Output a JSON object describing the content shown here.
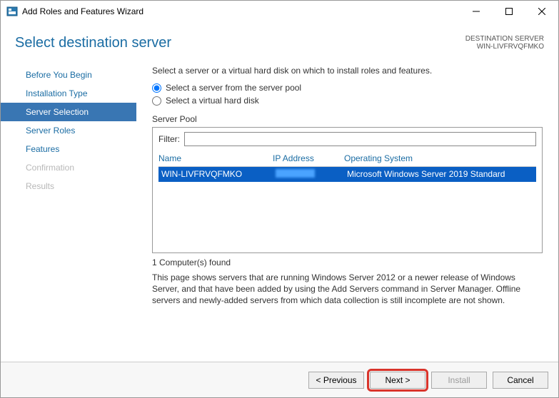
{
  "window": {
    "title": "Add Roles and Features Wizard"
  },
  "header": {
    "title": "Select destination server",
    "destLabel": "DESTINATION SERVER",
    "destValue": "WIN-LIVFRVQFMKO"
  },
  "sidebar": {
    "items": [
      {
        "label": "Before You Begin",
        "state": "normal"
      },
      {
        "label": "Installation Type",
        "state": "normal"
      },
      {
        "label": "Server Selection",
        "state": "active"
      },
      {
        "label": "Server Roles",
        "state": "normal"
      },
      {
        "label": "Features",
        "state": "normal"
      },
      {
        "label": "Confirmation",
        "state": "disabled"
      },
      {
        "label": "Results",
        "state": "disabled"
      }
    ]
  },
  "main": {
    "intro": "Select a server or a virtual hard disk on which to install roles and features.",
    "radio1": "Select a server from the server pool",
    "radio2": "Select a virtual hard disk",
    "poolLabel": "Server Pool",
    "filterLabel": "Filter:",
    "filterValue": "",
    "columns": {
      "name": "Name",
      "ip": "IP Address",
      "os": "Operating System"
    },
    "rows": [
      {
        "name": "WIN-LIVFRVQFMKO",
        "ip": "",
        "os": "Microsoft Windows Server 2019 Standard"
      }
    ],
    "found": "1 Computer(s) found",
    "note": "This page shows servers that are running Windows Server 2012 or a newer release of Windows Server, and that have been added by using the Add Servers command in Server Manager. Offline servers and newly-added servers from which data collection is still incomplete are not shown."
  },
  "footer": {
    "previous": "< Previous",
    "next": "Next >",
    "install": "Install",
    "cancel": "Cancel"
  }
}
